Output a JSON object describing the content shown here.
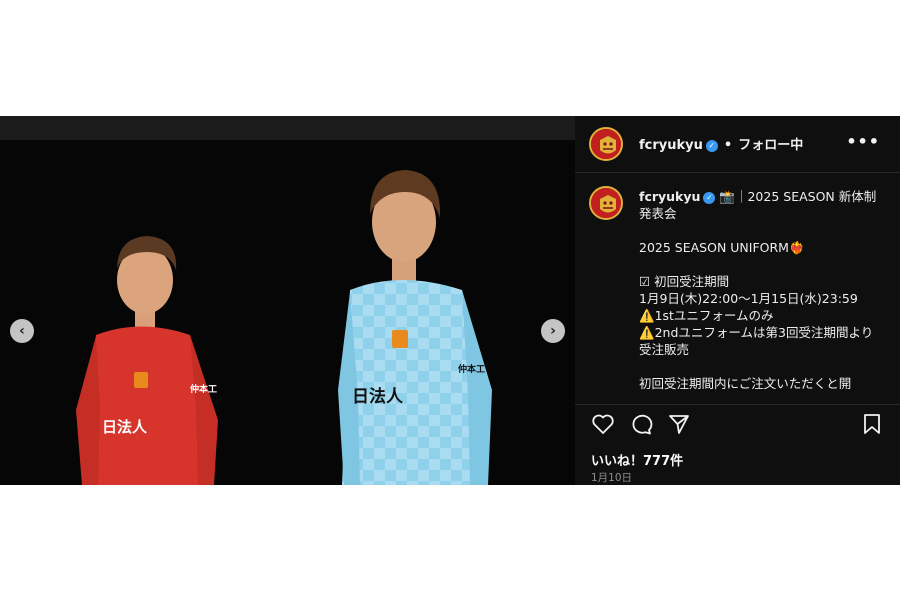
{
  "post": {
    "username": "fcryukyu",
    "verified_mark": "✓",
    "header_separator": "•",
    "follow_status": "フォロー中",
    "more_label": "•••",
    "likes": "いいね！777件",
    "date": "1月10日",
    "caption": {
      "title_emoji": "📸",
      "title_text": "｜2025 SEASON 新体制発表会",
      "lines": [
        "2025 SEASON UNIFORM❤️‍🔥",
        "",
        "☑ 初回受注期間",
        "1月9日(木)22:00〜1月15日(水)23:59",
        "⚠️1stユニフォームのみ",
        "⚠️2ndユニフォームは第3回受注期間より受注販売",
        "",
        "初回受注期間内にご注文いただくと開"
      ]
    }
  },
  "photo": {
    "nav_prev": "‹",
    "nav_next": "›",
    "left_shirt_sponsor": "日法人",
    "left_sleeve_text": "仲本工",
    "right_shirt_sponsor": "日法人",
    "right_sleeve_text": "仲本工",
    "colors": {
      "left_kit": "#d7352b",
      "right_kit": "#8fd0ea",
      "badge": "#e98a1e"
    }
  },
  "icons": {
    "like": "heart-icon",
    "comment": "comment-icon",
    "share": "share-icon",
    "save": "bookmark-icon"
  }
}
